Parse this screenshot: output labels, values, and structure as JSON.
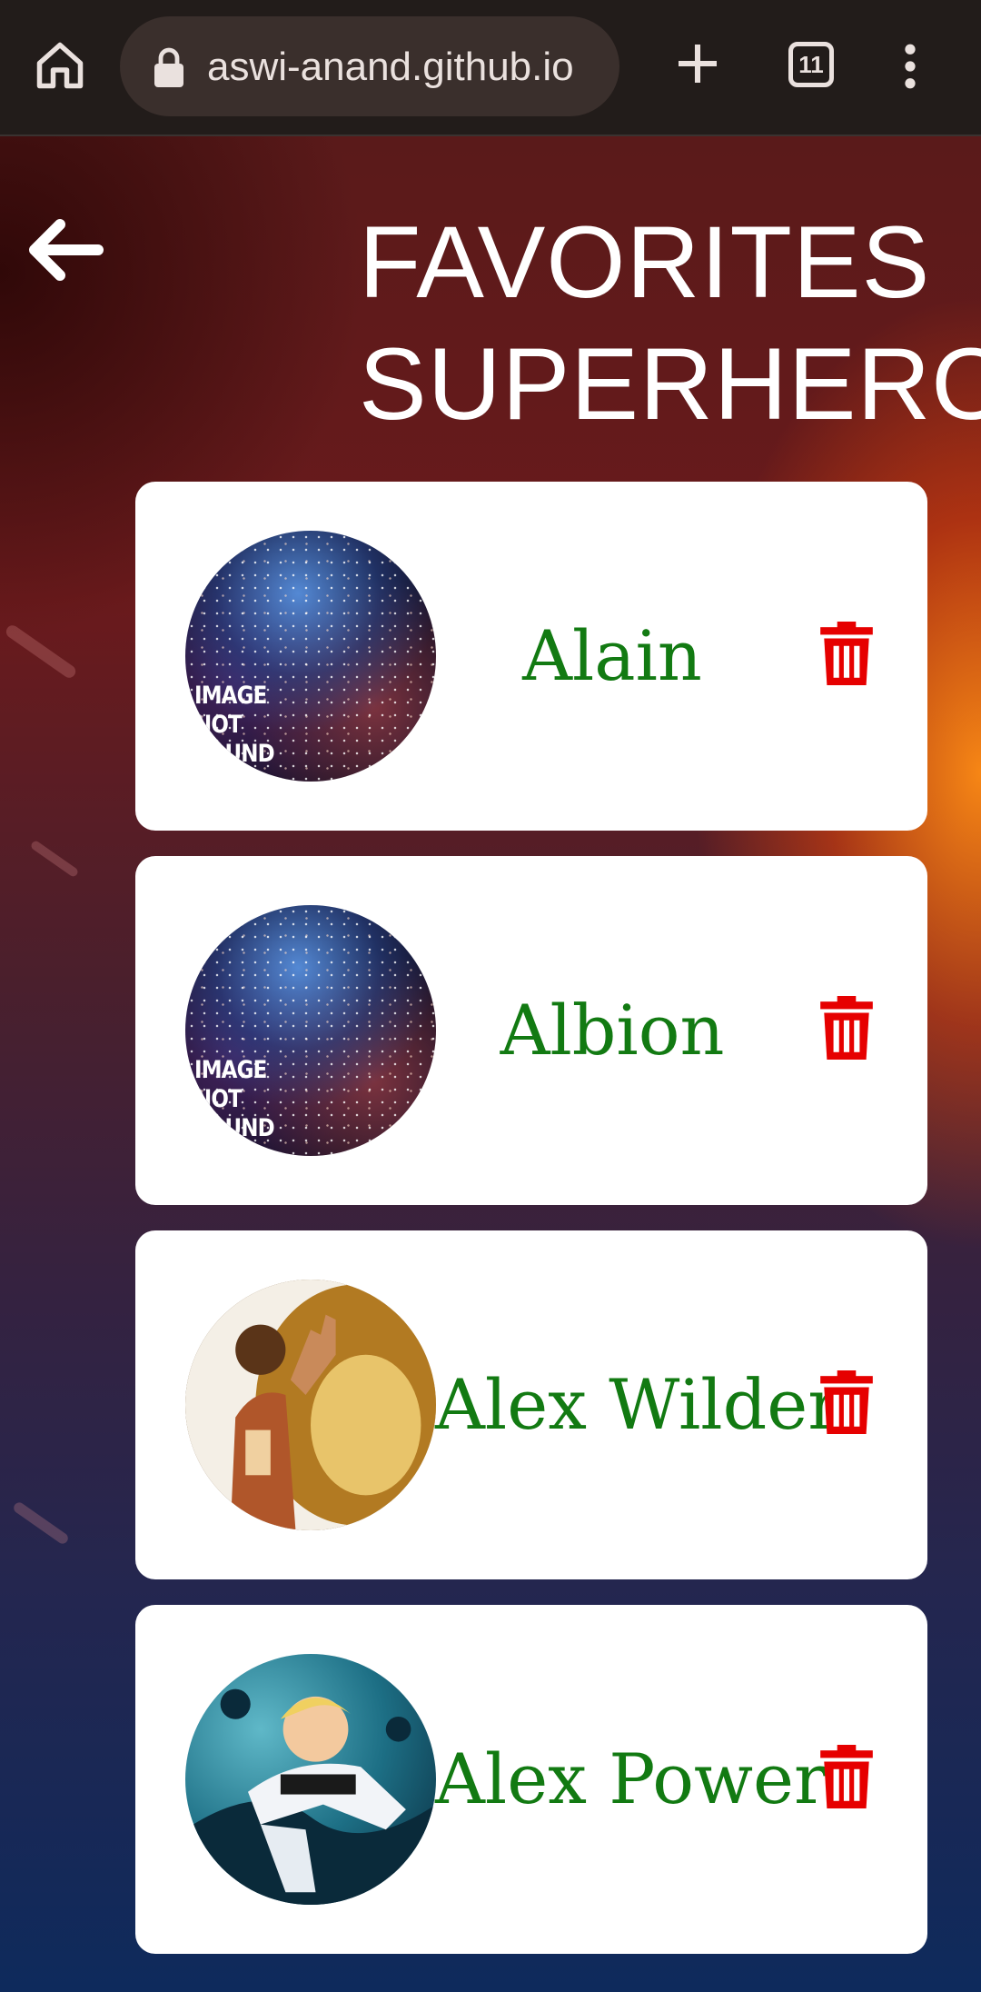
{
  "browser": {
    "url": "aswi-anand.github.io",
    "tab_count": "11"
  },
  "header": {
    "title_line1": "FAVORITES",
    "title_line2": "SUPERHERO"
  },
  "avatar_placeholder": {
    "line1": "IMAGE",
    "line2": "NOT",
    "line3": "FOUND"
  },
  "favorites": [
    {
      "name": "Alain",
      "image": "image-not-found"
    },
    {
      "name": "Albion",
      "image": "image-not-found"
    },
    {
      "name": "Alex Wilder",
      "image": "hero-portrait"
    },
    {
      "name": "Alex Power",
      "image": "hero-portrait"
    }
  ],
  "colors": {
    "name_text": "#127a12",
    "trash_icon": "#e60000",
    "card_background": "#ffffff"
  },
  "icons": {
    "home": "home-icon",
    "lock": "lock-icon",
    "new_tab": "plus-icon",
    "tabs": "tab-switcher-icon",
    "menu": "more-vert-icon",
    "back": "arrow-left-icon",
    "delete": "trash-icon"
  }
}
